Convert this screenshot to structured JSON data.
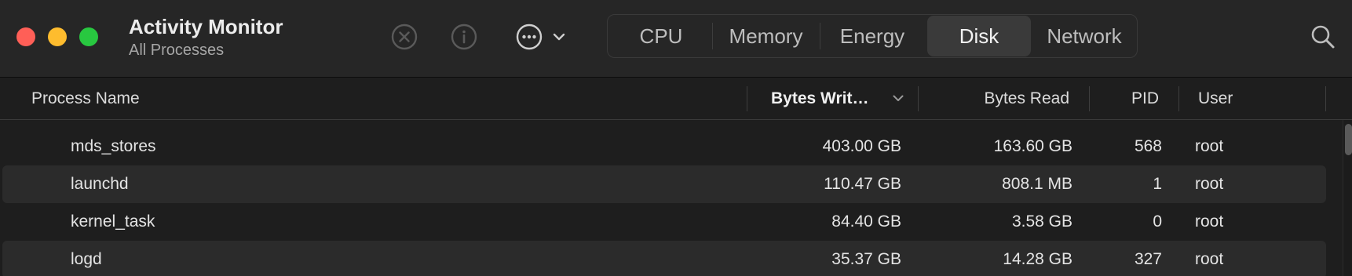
{
  "window": {
    "title": "Activity Monitor",
    "subtitle": "All Processes"
  },
  "toolbar": {
    "icons": [
      "stop-process-icon",
      "info-icon",
      "more-icon",
      "chevron-down-icon",
      "search-icon"
    ]
  },
  "tabs": [
    {
      "label": "CPU",
      "active": false
    },
    {
      "label": "Memory",
      "active": false
    },
    {
      "label": "Energy",
      "active": false
    },
    {
      "label": "Disk",
      "active": true
    },
    {
      "label": "Network",
      "active": false
    }
  ],
  "table": {
    "columns": {
      "name": "Process Name",
      "bytes_written": "Bytes Writ…",
      "bytes_read": "Bytes Read",
      "pid": "PID",
      "user": "User"
    },
    "sorted_by": "bytes_written",
    "rows": [
      {
        "name": "mds_stores",
        "bytes_written": "403.00 GB",
        "bytes_read": "163.60 GB",
        "pid": "568",
        "user": "root"
      },
      {
        "name": "launchd",
        "bytes_written": "110.47 GB",
        "bytes_read": "808.1 MB",
        "pid": "1",
        "user": "root"
      },
      {
        "name": "kernel_task",
        "bytes_written": "84.40 GB",
        "bytes_read": "3.58 GB",
        "pid": "0",
        "user": "root"
      },
      {
        "name": "logd",
        "bytes_written": "35.37 GB",
        "bytes_read": "14.28 GB",
        "pid": "327",
        "user": "root"
      }
    ]
  },
  "colors": {
    "close": "#ff5f57",
    "minimize": "#febc2e",
    "zoom": "#28c840",
    "background": "#1e1e1e",
    "row_stripe": "#2b2b2b",
    "active_tab": "#3a3a3a"
  }
}
